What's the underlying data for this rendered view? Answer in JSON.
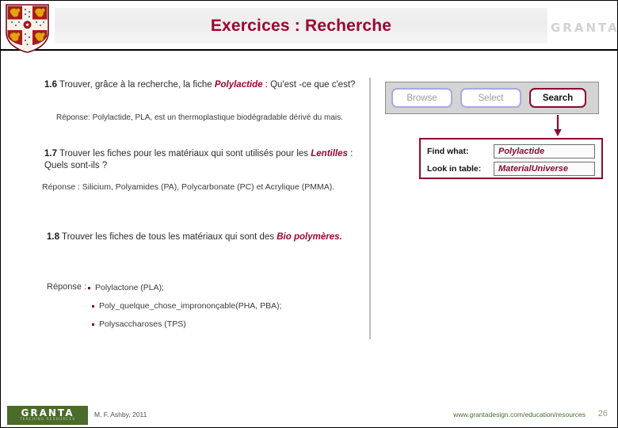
{
  "header": {
    "title": "Exercices : Recherche",
    "title_color": "#9c0433",
    "brand": "GRANTA",
    "crest_alt": "cambridge-coat-of-arms"
  },
  "exercises": [
    {
      "number": "1.6",
      "text_before": "Trouver, grâce à la recherche, la fiche ",
      "highlight": "Polylactide",
      "text_after": " : Qu'est -ce que c'est?",
      "answer": "Réponse: Polylactide, PLA,  est un thermoplastique biodégradable dérivé du mais."
    },
    {
      "number": "1.7",
      "text_before": "Trouver les fiches pour les matériaux qui sont utilisés pour les ",
      "highlight": "Lentilles",
      "text_after": " : Quels sont-ils ?",
      "answer": "Réponse : Silicium, Polyamides (PA), Polycarbonate (PC) et Acrylique (PMMA)."
    },
    {
      "number": "1.8",
      "text_before": "Trouver les fiches de tous les matériaux qui sont des ",
      "highlight": "Bio polymères.",
      "text_after": "",
      "answer": "Réponse :",
      "bullets": [
        "Polylactone (PLA);",
        "Poly_quelque_chose_imprononçable(PHA, PBA);",
        "Polysaccharoses (TPS)"
      ]
    }
  ],
  "app": {
    "toolbar": {
      "browse_label": "Browse",
      "select_label": "Select",
      "search_label": "Search",
      "active_accent": "#8b0b2e",
      "inactive_accent": "#a9a9e0"
    },
    "find_panel": {
      "find_what_label": "Find what:",
      "find_what_value": "Polylactide",
      "look_in_table_label": "Look in table:",
      "look_in_table_value": "MaterialUniverse",
      "accent": "#8b0b2e"
    },
    "arrow_color": "#8b0b2e"
  },
  "footer": {
    "logo_main": "GRANTA",
    "logo_sub": "TEACHING RESOURCES",
    "credit": "M. F. Ashby, 2011",
    "url": "www.grantadesign.com/education/resources",
    "page": "26",
    "logo_bg": "#4a6b2a"
  }
}
